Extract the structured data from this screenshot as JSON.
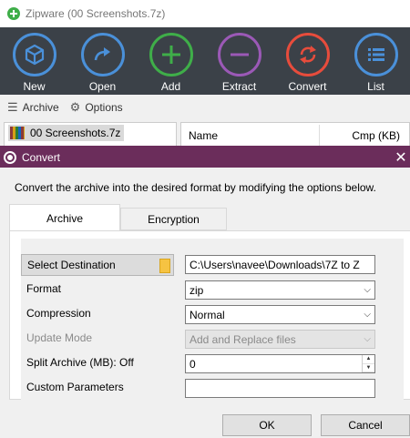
{
  "window": {
    "title": "Zipware (00 Screenshots.7z)"
  },
  "toolbar": {
    "buttons": [
      {
        "label": "New",
        "icon": "cube-icon",
        "color": "#4a90d9"
      },
      {
        "label": "Open",
        "icon": "redo-arrow-icon",
        "color": "#4a90d9"
      },
      {
        "label": "Add",
        "icon": "plus-icon",
        "color": "#3fae49"
      },
      {
        "label": "Extract",
        "icon": "minus-icon",
        "color": "#9b59b6"
      },
      {
        "label": "Convert",
        "icon": "convert-arrows-icon",
        "color": "#e74c3c"
      },
      {
        "label": "List",
        "icon": "list-icon",
        "color": "#4a90d9"
      }
    ]
  },
  "menubar": {
    "archive": "Archive",
    "options": "Options"
  },
  "tree": {
    "item": "00 Screenshots.7z"
  },
  "list": {
    "col_name": "Name",
    "col_cmp": "Cmp (KB)"
  },
  "dialog": {
    "title": "Convert",
    "description": "Convert the archive into the desired format by modifying the options below.",
    "tabs": [
      "Archive",
      "Encryption"
    ],
    "select_destination": "Select Destination",
    "destination_value": "C:\\Users\\navee\\Downloads\\7Z to Z",
    "format_label": "Format",
    "format_value": "zip",
    "compression_label": "Compression",
    "compression_value": "Normal",
    "update_mode_label": "Update Mode",
    "update_mode_value": "Add and Replace files",
    "split_label": "Split Archive (MB): Off",
    "split_value": "0",
    "custom_label": "Custom Parameters",
    "custom_value": "",
    "ok": "OK",
    "cancel": "Cancel"
  },
  "colors": {
    "toolbar_bg": "#3b4148",
    "dialog_title_bg": "#6b2d5b"
  }
}
